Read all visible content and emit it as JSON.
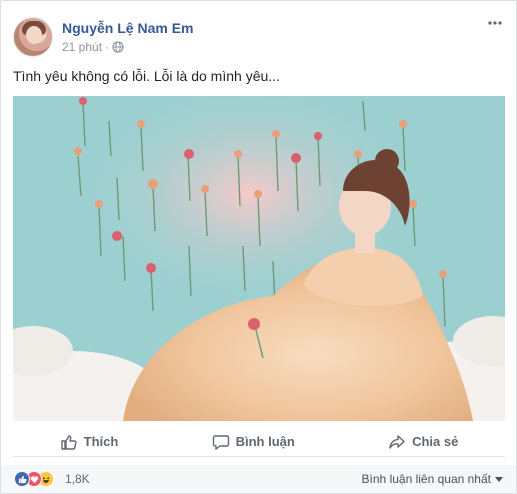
{
  "post": {
    "author": "Nguyễn Lệ Nam Em",
    "time": "21 phút",
    "text": "Tình yêu không có lỗi. Lỗi là do mình yêu..."
  },
  "actions": {
    "like": "Thích",
    "comment": "Bình luận",
    "share": "Chia sẻ"
  },
  "footer": {
    "reaction_count": "1,8K",
    "sort_label": "Bình luận liên quan nhất"
  },
  "icons": [
    "more-icon",
    "globe-icon",
    "like-icon",
    "comment-icon",
    "share-icon",
    "like-reaction-icon",
    "love-reaction-icon",
    "haha-reaction-icon",
    "caret-down-icon"
  ],
  "colors": {
    "author_link": "#365899",
    "like_blue": "#4267b2",
    "love_red": "#f25268",
    "haha_yellow": "#fcc841"
  }
}
